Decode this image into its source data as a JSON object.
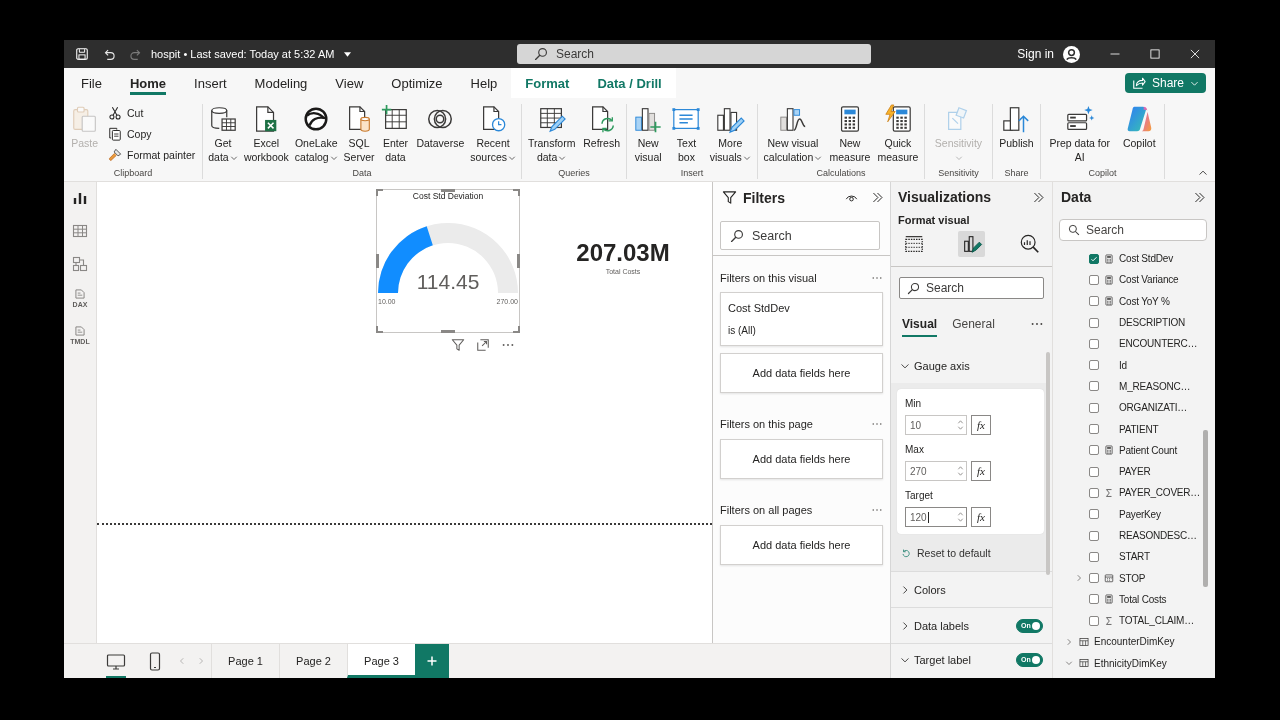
{
  "title_bar": {
    "document": "hospit • Last saved: Today at 5:32 AM",
    "search": {
      "placeholder": "Search"
    },
    "sign_in": "Sign in"
  },
  "tabs": [
    {
      "label": "File",
      "selected": false,
      "contextual": false
    },
    {
      "label": "Home",
      "selected": true,
      "contextual": false
    },
    {
      "label": "Insert",
      "selected": false,
      "contextual": false
    },
    {
      "label": "Modeling",
      "selected": false,
      "contextual": false
    },
    {
      "label": "View",
      "selected": false,
      "contextual": false
    },
    {
      "label": "Optimize",
      "selected": false,
      "contextual": false
    },
    {
      "label": "Help",
      "selected": false,
      "contextual": false
    },
    {
      "label": "Format",
      "selected": false,
      "contextual": true
    },
    {
      "label": "Data / Drill",
      "selected": false,
      "contextual": true
    }
  ],
  "share_button": {
    "label": "Share"
  },
  "ribbon": {
    "groups": [
      {
        "label": "Clipboard",
        "buttons": [
          {
            "kind": "large",
            "lines": [
              "Paste"
            ],
            "dropdown": false,
            "disabled": true
          },
          {
            "kind": "small",
            "lines": [
              "Cut"
            ],
            "dropdown": false,
            "disabled": false
          },
          {
            "kind": "small",
            "lines": [
              "Copy"
            ],
            "dropdown": false,
            "disabled": false
          },
          {
            "kind": "small",
            "lines": [
              "Format painter"
            ],
            "dropdown": false,
            "disabled": false
          }
        ]
      },
      {
        "label": "Data",
        "buttons": [
          {
            "kind": "large",
            "lines": [
              "Get",
              "data"
            ],
            "dropdown": true,
            "disabled": false
          },
          {
            "kind": "large",
            "lines": [
              "Excel",
              "workbook"
            ],
            "dropdown": false,
            "disabled": false
          },
          {
            "kind": "large",
            "lines": [
              "OneLake",
              "catalog"
            ],
            "dropdown": true,
            "disabled": false
          },
          {
            "kind": "large",
            "lines": [
              "SQL",
              "Server"
            ],
            "dropdown": false,
            "disabled": false
          },
          {
            "kind": "large",
            "lines": [
              "Enter",
              "data"
            ],
            "dropdown": false,
            "disabled": false
          },
          {
            "kind": "large",
            "lines": [
              "Dataverse"
            ],
            "dropdown": false,
            "disabled": false
          },
          {
            "kind": "large",
            "lines": [
              "Recent",
              "sources"
            ],
            "dropdown": true,
            "disabled": false
          }
        ]
      },
      {
        "label": "Queries",
        "buttons": [
          {
            "kind": "large",
            "lines": [
              "Transform",
              "data"
            ],
            "dropdown": true,
            "disabled": false
          },
          {
            "kind": "large",
            "lines": [
              "Refresh"
            ],
            "dropdown": false,
            "disabled": false
          }
        ]
      },
      {
        "label": "Insert",
        "buttons": [
          {
            "kind": "large",
            "lines": [
              "New",
              "visual"
            ],
            "dropdown": false,
            "disabled": false
          },
          {
            "kind": "large",
            "lines": [
              "Text",
              "box"
            ],
            "dropdown": false,
            "disabled": false
          },
          {
            "kind": "large",
            "lines": [
              "More",
              "visuals"
            ],
            "dropdown": true,
            "disabled": false
          }
        ]
      },
      {
        "label": "Calculations",
        "buttons": [
          {
            "kind": "large",
            "lines": [
              "New visual",
              "calculation"
            ],
            "dropdown": true,
            "disabled": false
          },
          {
            "kind": "large",
            "lines": [
              "New",
              "measure"
            ],
            "dropdown": false,
            "disabled": false
          },
          {
            "kind": "large",
            "lines": [
              "Quick",
              "measure"
            ],
            "dropdown": false,
            "disabled": false
          }
        ]
      },
      {
        "label": "Sensitivity",
        "buttons": [
          {
            "kind": "large",
            "lines": [
              "Sensitivity"
            ],
            "dropdown": true,
            "disabled": true
          }
        ]
      },
      {
        "label": "Share",
        "buttons": [
          {
            "kind": "large",
            "lines": [
              "Publish"
            ],
            "dropdown": false,
            "disabled": false
          }
        ]
      },
      {
        "label": "Copilot",
        "buttons": [
          {
            "kind": "large",
            "lines": [
              "Prep data for",
              "AI"
            ],
            "dropdown": false,
            "disabled": false
          },
          {
            "kind": "large",
            "lines": [
              "Copilot"
            ],
            "dropdown": false,
            "disabled": false
          }
        ]
      }
    ]
  },
  "view_rail": [
    {
      "selected": true
    },
    {
      "selected": false
    },
    {
      "selected": false
    },
    {
      "selected": false,
      "tag": "DAX"
    },
    {
      "selected": false,
      "tag": "TMDL"
    }
  ],
  "report_page": {
    "gauge": {
      "title": "Cost Std Deviation",
      "value": "114.45",
      "min": "10.00",
      "max": "270.00",
      "level": 0.4017,
      "selected": true
    },
    "card": {
      "value": "207.03M",
      "label": "Total Costs"
    }
  },
  "page_bar": {
    "views": [
      {
        "selected": true
      },
      {
        "selected": false
      }
    ],
    "pages": [
      {
        "label": "Page 1",
        "selected": false
      },
      {
        "label": "Page 2",
        "selected": false
      },
      {
        "label": "Page 3",
        "selected": true
      }
    ]
  },
  "filters_pane": {
    "title": "Filters",
    "search": {
      "placeholder": "Search"
    },
    "sections": [
      {
        "heading": "Filters on this visual",
        "filters": [
          {
            "field": "Cost StdDev",
            "condition": "is (All)"
          }
        ],
        "drop_zone": "Add data fields here"
      },
      {
        "heading": "Filters on this page",
        "drop_zone": "Add data fields here"
      },
      {
        "heading": "Filters on all pages",
        "drop_zone": "Add data fields here"
      }
    ]
  },
  "visualizations_pane": {
    "title": "Visualizations",
    "subtitle": "Format visual",
    "modes": [
      {
        "selected": false
      },
      {
        "selected": true
      },
      {
        "selected": false
      }
    ],
    "search": {
      "placeholder": "Search"
    },
    "tabs": [
      {
        "label": "Visual",
        "selected": true
      },
      {
        "label": "General",
        "selected": false
      }
    ],
    "sections": [
      {
        "title": "Gauge axis",
        "expanded": true,
        "fields": [
          {
            "label": "Min",
            "value": "10",
            "fx": "fx",
            "focused": false
          },
          {
            "label": "Max",
            "value": "270",
            "fx": "fx",
            "focused": false
          },
          {
            "label": "Target",
            "value": "120",
            "fx": "fx",
            "focused": true
          }
        ],
        "reset": "Reset to default"
      },
      {
        "title": "Colors",
        "expanded": false
      },
      {
        "title": "Data labels",
        "expanded": false,
        "toggle": {
          "label": "On",
          "on": true
        }
      },
      {
        "title": "Target label",
        "expanded": true,
        "toggle": {
          "label": "On",
          "on": true
        }
      }
    ]
  },
  "data_pane": {
    "title": "Data",
    "search": {
      "placeholder": "Search"
    },
    "fields": [
      {
        "name": "Cost StdDev",
        "kind": "measure",
        "checked": true
      },
      {
        "name": "Cost Variance",
        "kind": "measure",
        "checked": false
      },
      {
        "name": "Cost YoY %",
        "kind": "measure",
        "checked": false
      },
      {
        "name": "DESCRIPTION",
        "kind": "text",
        "checked": false
      },
      {
        "name": "ENCOUNTERC…",
        "kind": "text",
        "checked": false
      },
      {
        "name": "Id",
        "kind": "text",
        "checked": false
      },
      {
        "name": "M_REASONC…",
        "kind": "text",
        "checked": false
      },
      {
        "name": "ORGANIZATI…",
        "kind": "text",
        "checked": false
      },
      {
        "name": "PATIENT",
        "kind": "text",
        "checked": false
      },
      {
        "name": "Patient Count",
        "kind": "measure",
        "checked": false
      },
      {
        "name": "PAYER",
        "kind": "text",
        "checked": false
      },
      {
        "name": "PAYER_COVER…",
        "kind": "sum",
        "checked": false
      },
      {
        "name": "PayerKey",
        "kind": "text",
        "checked": false
      },
      {
        "name": "REASONDESC…",
        "kind": "text",
        "checked": false
      },
      {
        "name": "START",
        "kind": "text",
        "checked": false
      },
      {
        "name": "STOP",
        "kind": "date",
        "checked": false
      },
      {
        "name": "Total Costs",
        "kind": "measure",
        "checked": false
      },
      {
        "name": "TOTAL_CLAIM…",
        "kind": "sum",
        "checked": false
      }
    ],
    "tables": [
      {
        "name": "EncounterDimKey",
        "expanded": false
      },
      {
        "name": "EthnicityDimKey",
        "expanded": true
      }
    ]
  }
}
